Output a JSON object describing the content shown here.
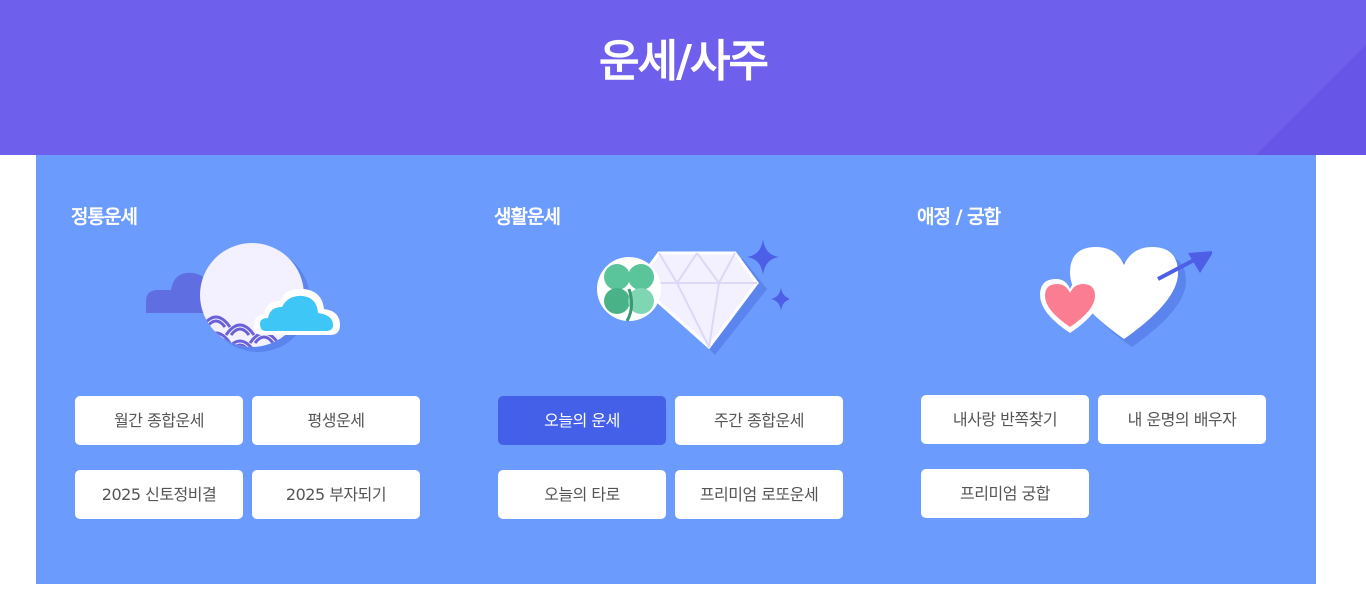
{
  "header": {
    "title": "운세/사주"
  },
  "categories": [
    {
      "title": "정통운세",
      "icon": "moon-cloud-icon",
      "buttons": [
        "월간 종합운세",
        "평생운세",
        "2025 신토정비결",
        "2025 부자되기"
      ]
    },
    {
      "title": "생활운세",
      "icon": "diamond-clover-icon",
      "buttons": [
        "오늘의 운세",
        "주간 종합운세",
        "오늘의 타로",
        "프리미엄 로또운세"
      ],
      "active_button": "오늘의 운세"
    },
    {
      "title": "애정 / 궁합",
      "icon": "hearts-arrow-icon",
      "buttons": [
        "내사랑 반쪽찾기",
        "내 운명의 배우자",
        "프리미엄 궁합"
      ]
    }
  ],
  "colors": {
    "header_bg": "#6e5fec",
    "panel_bg": "#6c9bfe",
    "active_button": "#4460e8"
  }
}
